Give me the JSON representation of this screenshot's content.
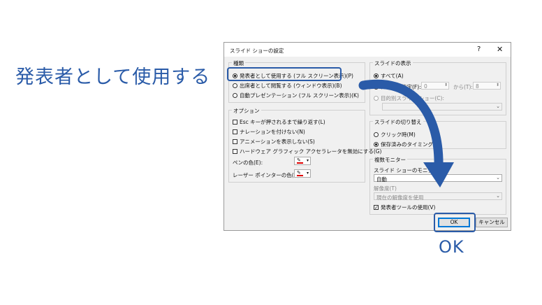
{
  "caption": "発表者として使用する",
  "ok_caption": "OK",
  "dialog": {
    "title": "スライド ショーの設定",
    "help": "?",
    "close": "✕",
    "show_type": {
      "label": "種類",
      "options": [
        {
          "label": "発表者として使用する (フル スクリーン表示)(P)",
          "selected": true
        },
        {
          "label": "出席者として閲覧する (ウィンドウ表示)(B)",
          "selected": false
        },
        {
          "label": "自動プレゼンテーション (フル スクリーン表示)(K)",
          "selected": false
        }
      ]
    },
    "options": {
      "label": "オプション",
      "checks": [
        {
          "label": "Esc キーが押されるまで繰り返す(L)",
          "checked": false
        },
        {
          "label": "ナレーションを付けない(N)",
          "checked": false
        },
        {
          "label": "アニメーションを表示しない(S)",
          "checked": false
        },
        {
          "label": "ハードウェア グラフィック アクセラレータを無効にする(G)",
          "checked": false
        }
      ],
      "pen_color_label": "ペンの色(E):",
      "laser_color_label": "レーザー ポインターの色(R):",
      "pen_color": "#e00000",
      "laser_color": "#e00000"
    },
    "show_slides": {
      "label": "スライドの表示",
      "all": "すべて(A)",
      "range": "スライド指定(F):",
      "from_value": "0",
      "to_label": "から(T):",
      "to_value": "8",
      "custom": "目的別スライド ショー(C):"
    },
    "advance": {
      "label": "スライドの切り替え",
      "manual": "クリック時(M)",
      "timings": "保存済みのタイミング(U)"
    },
    "monitors": {
      "label": "複数モニター",
      "monitor_label": "スライド ショーのモニター(O):",
      "monitor_value": "自動",
      "resolution_label": "解像度(T)",
      "resolution_value": "現在の解像度を使用",
      "presenter_view": "発表者ツールの使用(V)",
      "presenter_view_checked": true
    },
    "ok_button": "OK",
    "cancel_button": "キャンセル"
  },
  "colors": {
    "accent": "#2a5ba8"
  }
}
